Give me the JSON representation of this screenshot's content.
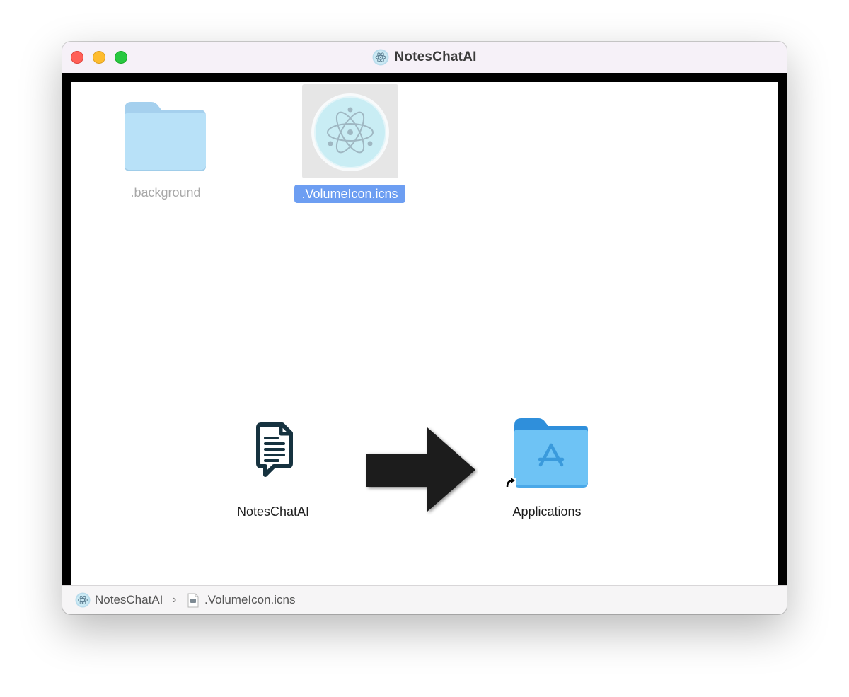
{
  "window": {
    "title": "NotesChatAI",
    "title_icon": "electron-atom-icon"
  },
  "desktop_items": [
    {
      "label": ".background",
      "icon": "folder-icon",
      "state": "hidden-dimmed"
    },
    {
      "label": ".VolumeIcon.icns",
      "icon": "electron-atom-icon",
      "state": "selected"
    },
    {
      "label": "NotesChatAI",
      "icon": "notes-chat-app-icon",
      "state": "normal"
    },
    {
      "label": "Applications",
      "icon": "applications-folder-alias-icon",
      "state": "normal"
    }
  ],
  "install_arrow": {
    "icon": "right-arrow-icon"
  },
  "status_bar": {
    "path": [
      {
        "label": "NotesChatAI",
        "icon": "electron-atom-icon"
      },
      {
        "label": ".VolumeIcon.icns",
        "icon": "icns-file-icon"
      }
    ],
    "separator": "›"
  },
  "colors": {
    "selection": "#6d9ef2",
    "folder_light": "#b6def6",
    "folder_blue": "#6ec3f5",
    "close": "#ff5f57",
    "minimize": "#febc2e",
    "zoom": "#28c840"
  }
}
